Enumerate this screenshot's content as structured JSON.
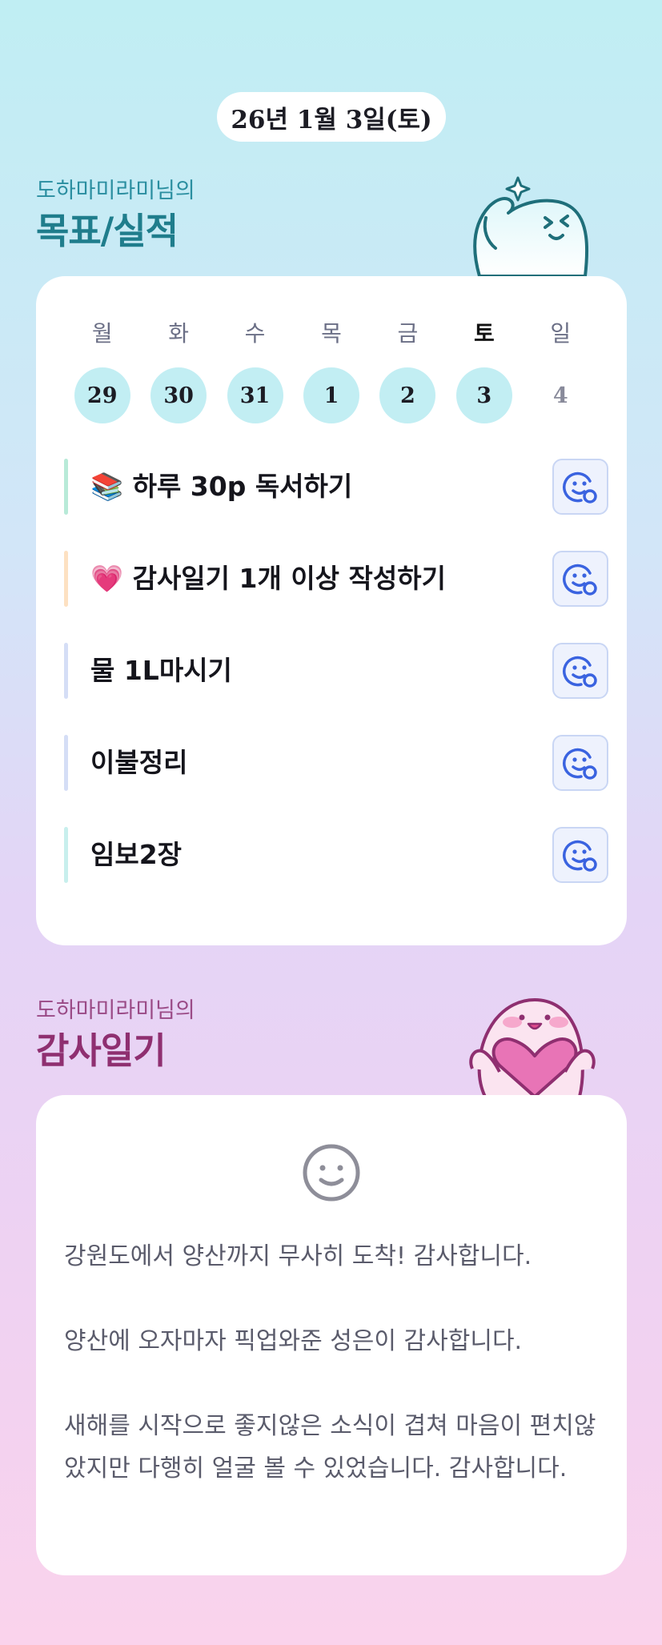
{
  "header": {
    "date": "26년 1월 3일(토)"
  },
  "goals_section": {
    "subtitle": "도하마미라미님의",
    "title": "목표/실적",
    "week": {
      "days": [
        {
          "weekday": "월",
          "date": "29",
          "filled": true,
          "today": false
        },
        {
          "weekday": "화",
          "date": "30",
          "filled": true,
          "today": false
        },
        {
          "weekday": "수",
          "date": "31",
          "filled": true,
          "today": false
        },
        {
          "weekday": "목",
          "date": "1",
          "filled": true,
          "today": false
        },
        {
          "weekday": "금",
          "date": "2",
          "filled": true,
          "today": false
        },
        {
          "weekday": "토",
          "date": "3",
          "filled": true,
          "today": true
        },
        {
          "weekday": "일",
          "date": "4",
          "filled": false,
          "today": false
        }
      ]
    },
    "goals": [
      {
        "text": "📚 하루 30p 독서하기",
        "bar_color": "#b8ead8"
      },
      {
        "text": "💗 감사일기 1개 이상 작성하기",
        "bar_color": "#fde1c2"
      },
      {
        "text": "물 1L마시기",
        "bar_color": "#d5def6"
      },
      {
        "text": "이불정리",
        "bar_color": "#d5def6"
      },
      {
        "text": "임보2장",
        "bar_color": "#c8efed"
      }
    ],
    "status_icon": "smiley-add-icon"
  },
  "gratitude_section": {
    "subtitle": "도하마미라미님의",
    "title": "감사일기",
    "mood_icon": "smiley-icon",
    "entries": [
      "강원도에서 양산까지 무사히 도착! 감사합니다.",
      "양산에 오자마자 픽업와준 성은이 감사합니다.",
      "새해를 시작으로 좋지않은 소식이 겹쳐 마음이 편치않았지만 다행히 얼굴 볼 수 있었습니다. 감사합니다."
    ]
  },
  "colors": {
    "accent_teal": "#1f7d8c",
    "accent_magenta": "#8f2f70",
    "date_circle": "#c2eef3",
    "icon_blue": "#3a63e0"
  }
}
